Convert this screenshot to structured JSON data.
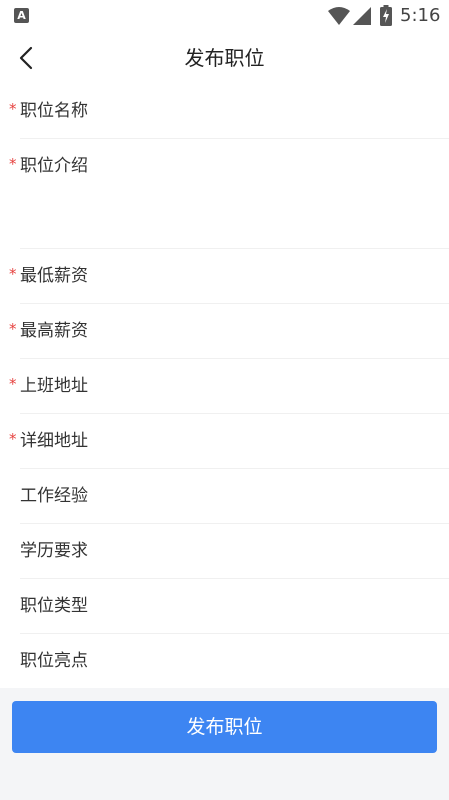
{
  "status_bar": {
    "badge": "A",
    "time": "5:16"
  },
  "header": {
    "title": "发布职位"
  },
  "form": {
    "fields": [
      {
        "label": "职位名称",
        "required": "*"
      },
      {
        "label": "职位介绍",
        "required": "*"
      },
      {
        "label": "最低薪资",
        "required": "*"
      },
      {
        "label": "最高薪资",
        "required": "*"
      },
      {
        "label": "上班地址",
        "required": "*"
      },
      {
        "label": "详细地址",
        "required": "*"
      },
      {
        "label": "工作经验"
      },
      {
        "label": "学历要求"
      },
      {
        "label": "职位类型"
      },
      {
        "label": "职位亮点"
      }
    ]
  },
  "submit": {
    "label": "发布职位"
  },
  "colors": {
    "accent": "#3d85f2",
    "required": "#e64340",
    "background": "#f4f5f7"
  },
  "icons": {
    "back": "chevron-left-icon",
    "wifi": "wifi-icon",
    "signal": "signal-icon",
    "battery": "battery-charging-icon"
  }
}
